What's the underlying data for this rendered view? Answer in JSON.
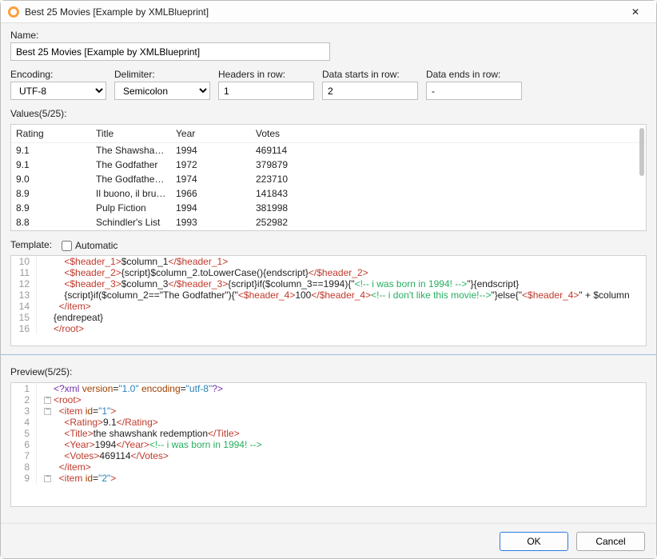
{
  "title": "Best 25 Movies [Example by XMLBlueprint]",
  "labels": {
    "name": "Name:",
    "encoding": "Encoding:",
    "delimiter": "Delimiter:",
    "headers_in_row": "Headers in row:",
    "data_starts": "Data starts in row:",
    "data_ends": "Data ends in row:",
    "values": "Values(5/25):",
    "template": "Template:",
    "automatic": "Automatic",
    "preview": "Preview(5/25):"
  },
  "fields": {
    "name": "Best 25 Movies [Example by XMLBlueprint]",
    "encoding": "UTF-8",
    "delimiter": "Semicolon",
    "headers_row": "1",
    "data_start": "2",
    "data_end": "-"
  },
  "table": {
    "headers": [
      "Rating",
      "Title",
      "Year",
      "Votes"
    ],
    "rows": [
      [
        "9.1",
        "The Shawshank ...",
        "1994",
        "469114"
      ],
      [
        "9.1",
        "The Godfather",
        "1972",
        "379879"
      ],
      [
        "9.0",
        "The Godfather: ...",
        "1974",
        "223710"
      ],
      [
        "8.9",
        "Il buono, il brut...",
        "1966",
        "141843"
      ],
      [
        "8.9",
        "Pulp Fiction",
        "1994",
        "381998"
      ],
      [
        "8.8",
        "Schindler's List",
        "1993",
        "252982"
      ]
    ]
  },
  "template_lines": [
    {
      "n": "10",
      "html": "&nbsp;&nbsp;&nbsp;&nbsp;<span class='tag'>&lt;$header_1&gt;</span><span class='plain'>$column_1</span><span class='tag'>&lt;/$header_1&gt;</span>"
    },
    {
      "n": "11",
      "html": "&nbsp;&nbsp;&nbsp;&nbsp;<span class='tag'>&lt;$header_2&gt;</span><span class='plain'>{script}$column_2.toLowerCase(){endscript}</span><span class='tag'>&lt;/$header_2&gt;</span>"
    },
    {
      "n": "12",
      "html": "&nbsp;&nbsp;&nbsp;&nbsp;<span class='tag'>&lt;$header_3&gt;</span><span class='plain'>$column_3</span><span class='tag'>&lt;/$header_3&gt;</span><span class='plain'>{script}if($column_3==1994){&quot;</span><span class='comment'>&lt;!-- i was born in 1994! --&gt;</span><span class='plain'>&quot;}{endscript}</span>"
    },
    {
      "n": "13",
      "html": "&nbsp;&nbsp;&nbsp;&nbsp;<span class='plain'>{script}if($column_2==&quot;The Godfather&quot;){&quot;</span><span class='tag'>&lt;$header_4&gt;</span><span class='plain'>100</span><span class='tag'>&lt;/$header_4&gt;</span><span class='comment'>&lt;!-- i don't like this movie!--&gt;</span><span class='plain'>&quot;}else{&quot;</span><span class='tag'>&lt;$header_4&gt;</span><span class='plain'>&quot; + $column</span>"
    },
    {
      "n": "14",
      "html": "&nbsp;&nbsp;<span class='tag'>&lt;/item&gt;</span>"
    },
    {
      "n": "15",
      "html": "<span class='plain'>{endrepeat}</span>"
    },
    {
      "n": "16",
      "html": "<span class='tag'>&lt;/root&gt;</span>"
    }
  ],
  "preview_lines": [
    {
      "n": "1",
      "html": "<span class='pi'>&lt;?xml</span> <span class='attr'>version</span>=<span class='str'>&quot;1.0&quot;</span> <span class='attr'>encoding</span>=<span class='str'>&quot;utf-8&quot;</span><span class='pi'>?&gt;</span>"
    },
    {
      "n": "2",
      "fold": true,
      "html": "<span class='tag'>&lt;root&gt;</span>"
    },
    {
      "n": "3",
      "fold": true,
      "html": "&nbsp;&nbsp;<span class='tag'>&lt;item</span> <span class='attr'>id</span>=<span class='str'>&quot;1&quot;</span><span class='tag'>&gt;</span>"
    },
    {
      "n": "4",
      "html": "&nbsp;&nbsp;&nbsp;&nbsp;<span class='tag'>&lt;Rating&gt;</span><span class='plain'>9.1</span><span class='tag'>&lt;/Rating&gt;</span>"
    },
    {
      "n": "5",
      "html": "&nbsp;&nbsp;&nbsp;&nbsp;<span class='tag'>&lt;Title&gt;</span><span class='plain'>the shawshank redemption</span><span class='tag'>&lt;/Title&gt;</span>"
    },
    {
      "n": "6",
      "html": "&nbsp;&nbsp;&nbsp;&nbsp;<span class='tag'>&lt;Year&gt;</span><span class='plain'>1994</span><span class='tag'>&lt;/Year&gt;</span><span class='comment'>&lt;!-- i was born in 1994! --&gt;</span>"
    },
    {
      "n": "7",
      "html": "&nbsp;&nbsp;&nbsp;&nbsp;<span class='tag'>&lt;Votes&gt;</span><span class='plain'>469114</span><span class='tag'>&lt;/Votes&gt;</span>"
    },
    {
      "n": "8",
      "html": "&nbsp;&nbsp;<span class='tag'>&lt;/item&gt;</span>"
    },
    {
      "n": "9",
      "fold": true,
      "html": "&nbsp;&nbsp;<span class='tag'>&lt;item</span> <span class='attr'>id</span>=<span class='str'>&quot;2&quot;</span><span class='tag'>&gt;</span>"
    }
  ],
  "buttons": {
    "ok": "OK",
    "cancel": "Cancel"
  }
}
